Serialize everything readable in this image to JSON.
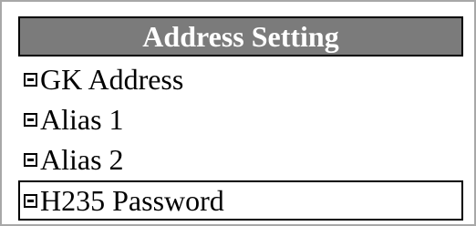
{
  "panel": {
    "title": "Address Setting",
    "items": [
      {
        "label": "GK Address",
        "icon": "minus-box-icon",
        "selected": false
      },
      {
        "label": "Alias 1",
        "icon": "minus-box-icon",
        "selected": false
      },
      {
        "label": "Alias 2",
        "icon": "minus-box-icon",
        "selected": false
      },
      {
        "label": "H235 Password",
        "icon": "minus-box-icon",
        "selected": true
      }
    ]
  },
  "colors": {
    "title_background": "#7b7b7b",
    "title_text": "#ffffff",
    "frame_border": "#a8a8a8",
    "selection_border": "#000000"
  }
}
